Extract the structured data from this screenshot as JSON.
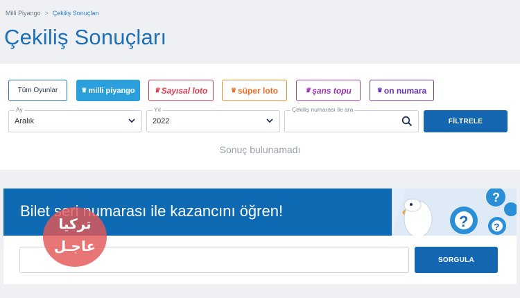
{
  "breadcrumb": {
    "home": "Milli Piyango",
    "separator": ">",
    "current": "Çekiliş Sonuçları"
  },
  "page_title": "Çekiliş Sonuçları",
  "games": {
    "all": "Tüm Oyunlar",
    "milli": "milli piyango",
    "sayisal": "Sayısal loto",
    "super": "süper loto",
    "sans": "şans topu",
    "on": "on numara"
  },
  "filters": {
    "month_label": "Ay",
    "month_value": "Aralık",
    "year_label": "Yıl",
    "year_value": "2022",
    "search_label": "Çekiliş numarası ile ara",
    "search_value": "",
    "filter_button": "FİLTRELE"
  },
  "no_result": "Sonuç bulunamadı",
  "bilet": {
    "title": "Bilet seri numarası ile kazancını öğren!",
    "input_value": "",
    "button": "SORGULA"
  },
  "watermark": {
    "line1": "تركيا",
    "line2": "عاجـل"
  },
  "colors": {
    "brand_blue": "#1467b0",
    "title_blue": "#1c6fb6",
    "milli_blue": "#2a9fdc",
    "sayisal_red": "#e23b4c",
    "super_orange": "#f26a21",
    "sans_purple": "#9b2fb0",
    "on_purple": "#6a2fb3",
    "watermark_red": "#e35858"
  },
  "icons": {
    "month_chevron": "chevron-down-icon",
    "year_chevron": "chevron-down-icon",
    "search": "search-icon"
  }
}
